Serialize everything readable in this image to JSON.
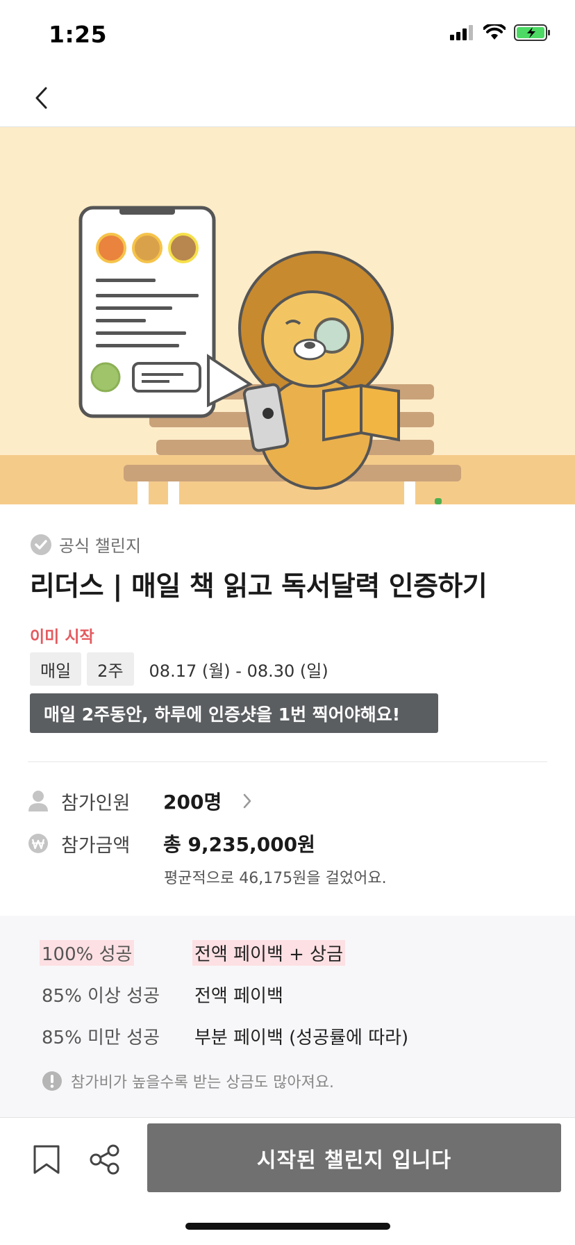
{
  "status_bar": {
    "time": "1:25"
  },
  "colors": {
    "accent_red": "#e4595e",
    "banner_bg": "#5b5e61",
    "cta_bg": "#707070",
    "highlight": "#fde0e3",
    "hero_bg": "#fdecc8"
  },
  "challenge": {
    "badge": "공식 챌린지",
    "title": "리더스 | 매일 책 읽고 독서달력 인증하기",
    "status": "이미 시작",
    "frequency": "매일",
    "duration": "2주",
    "dates": "08.17 (월) - 08.30 (일)",
    "banner": "매일 2주동안, 하루에 인증샷을 1번 찍어야해요!"
  },
  "participants": {
    "label": "참가인원",
    "value": "200명"
  },
  "amount": {
    "label": "참가금액",
    "value": "총 9,235,000원",
    "sub": "평균적으로 46,175원을 걸었어요."
  },
  "rewards": [
    {
      "condition": "100% 성공",
      "result": "전액 페이백 + 상금"
    },
    {
      "condition": "85% 이상 성공",
      "result": "전액 페이백"
    },
    {
      "condition": "85% 미만 성공",
      "result": "부분 페이백 (성공률에 따라)"
    }
  ],
  "reward_note": "참가비가 높을수록 받는 상금도 많아져요.",
  "cta": {
    "label": "시작된 챌린지 입니다"
  },
  "icons": [
    "back-arrow-icon",
    "verified-check-icon",
    "person-icon",
    "won-icon",
    "alert-icon",
    "bookmark-icon",
    "share-icon",
    "signal-icon",
    "wifi-icon",
    "battery-icon"
  ]
}
